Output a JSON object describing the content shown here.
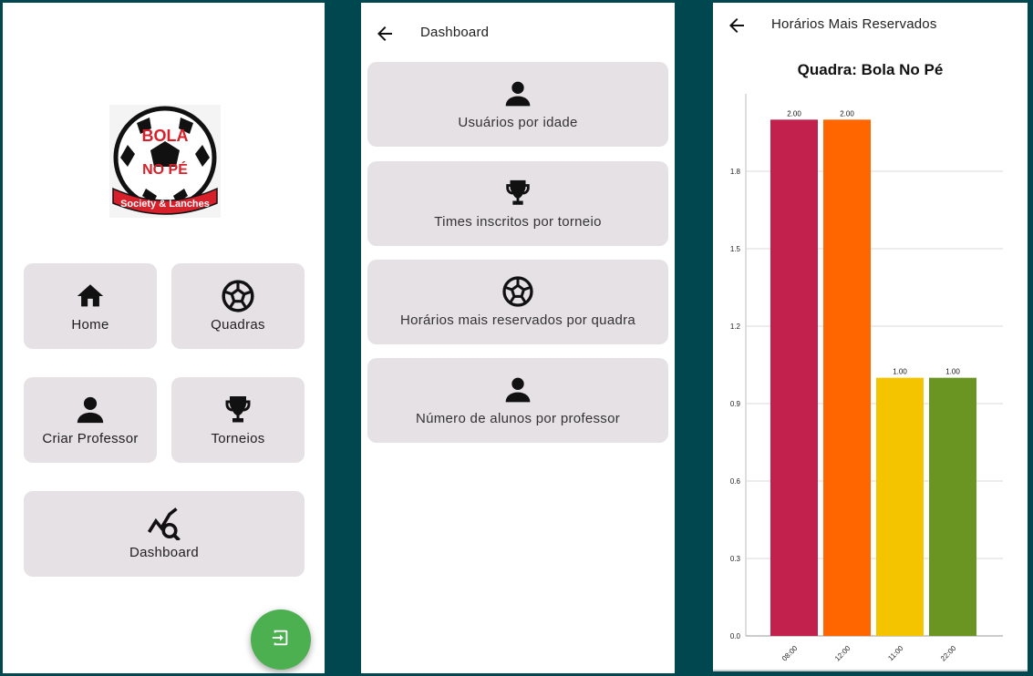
{
  "home": {
    "logo": {
      "line1": "BOLA",
      "line2": "NO PÉ",
      "banner": "Society & Lanches"
    },
    "cards": [
      {
        "label": "Home",
        "icon": "home-icon"
      },
      {
        "label": "Quadras",
        "icon": "soccer-ball-icon"
      },
      {
        "label": "Criar Professor",
        "icon": "person-icon"
      },
      {
        "label": "Torneios",
        "icon": "trophy-icon"
      },
      {
        "label": "Dashboard",
        "icon": "analytics-icon"
      }
    ],
    "fab": {
      "icon": "logout-icon",
      "color": "#4caf50"
    }
  },
  "dashboard": {
    "title": "Dashboard",
    "items": [
      {
        "label": "Usuários por idade",
        "icon": "person-icon"
      },
      {
        "label": "Times inscritos por torneio",
        "icon": "trophy-icon"
      },
      {
        "label": "Horários mais reservados por quadra",
        "icon": "soccer-ball-icon"
      },
      {
        "label": "Número de alunos por professor",
        "icon": "person-icon"
      }
    ]
  },
  "report": {
    "title": "Horários Mais Reservados"
  },
  "chart_data": {
    "type": "bar",
    "title": "Quadra: Bola No Pé",
    "categories": [
      "08:00",
      "12:00",
      "11:00",
      "22:00"
    ],
    "values": [
      2.0,
      2.0,
      1.0,
      1.0
    ],
    "value_labels": [
      "2.00",
      "2.00",
      "1.00",
      "1.00"
    ],
    "colors": [
      "#c2214e",
      "#ff6600",
      "#f5c400",
      "#6b9523"
    ],
    "yticks": [
      "0.0",
      "0.3",
      "0.6",
      "0.9",
      "1.2",
      "1.5",
      "1.8"
    ],
    "ylim": [
      0,
      2.1
    ],
    "grid": true,
    "xlabel": "",
    "ylabel": ""
  }
}
